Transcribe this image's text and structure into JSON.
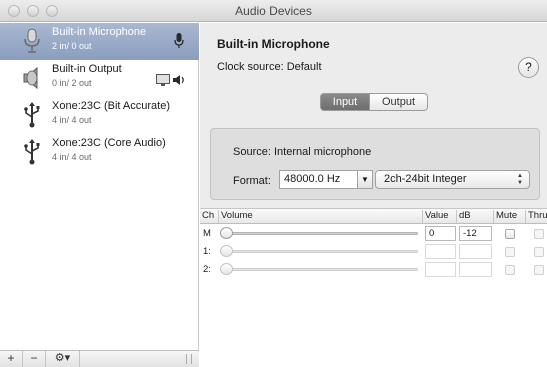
{
  "window": {
    "title": "Audio Devices"
  },
  "sidebar": {
    "devices": [
      {
        "name": "Built-in Microphone",
        "io": "2 in/ 0 out",
        "icon": "microphone-icon",
        "selected": true
      },
      {
        "name": "Built-in Output",
        "io": "0 in/ 2 out",
        "icon": "speaker-icon",
        "selected": false
      },
      {
        "name": "Xone:23C (Bit Accurate)",
        "io": "4 in/ 4 out",
        "icon": "usb-icon",
        "selected": false
      },
      {
        "name": "Xone:23C (Core Audio)",
        "io": "4 in/ 4 out",
        "icon": "usb-icon",
        "selected": false
      }
    ],
    "toolbar": {
      "add": "+",
      "remove": "−",
      "gear": "⚙▾"
    }
  },
  "detail": {
    "device_name": "Built-in Microphone",
    "clock_source": "Clock source: Default",
    "help": "?",
    "tabs": [
      {
        "label": "Input",
        "active": true
      },
      {
        "label": "Output",
        "active": false
      }
    ],
    "source": "Source: Internal microphone",
    "format_label": "Format:",
    "sample_rate": "48000.0 Hz",
    "bit_format": "2ch-24bit Integer"
  },
  "table": {
    "headers": {
      "ch": "Ch",
      "volume": "Volume",
      "value": "Value",
      "db": "dB",
      "mute": "Mute",
      "thru": "Thru"
    },
    "rows": [
      {
        "ch": "M",
        "value": "0",
        "db": "-12",
        "enabled": true
      },
      {
        "ch": "1:",
        "value": "",
        "db": "",
        "enabled": false
      },
      {
        "ch": "2:",
        "value": "",
        "db": "",
        "enabled": false
      }
    ]
  },
  "colors": {
    "selection": "#8a9ec0",
    "active_tab": "#7a7a7a",
    "panel": "#dedede"
  }
}
